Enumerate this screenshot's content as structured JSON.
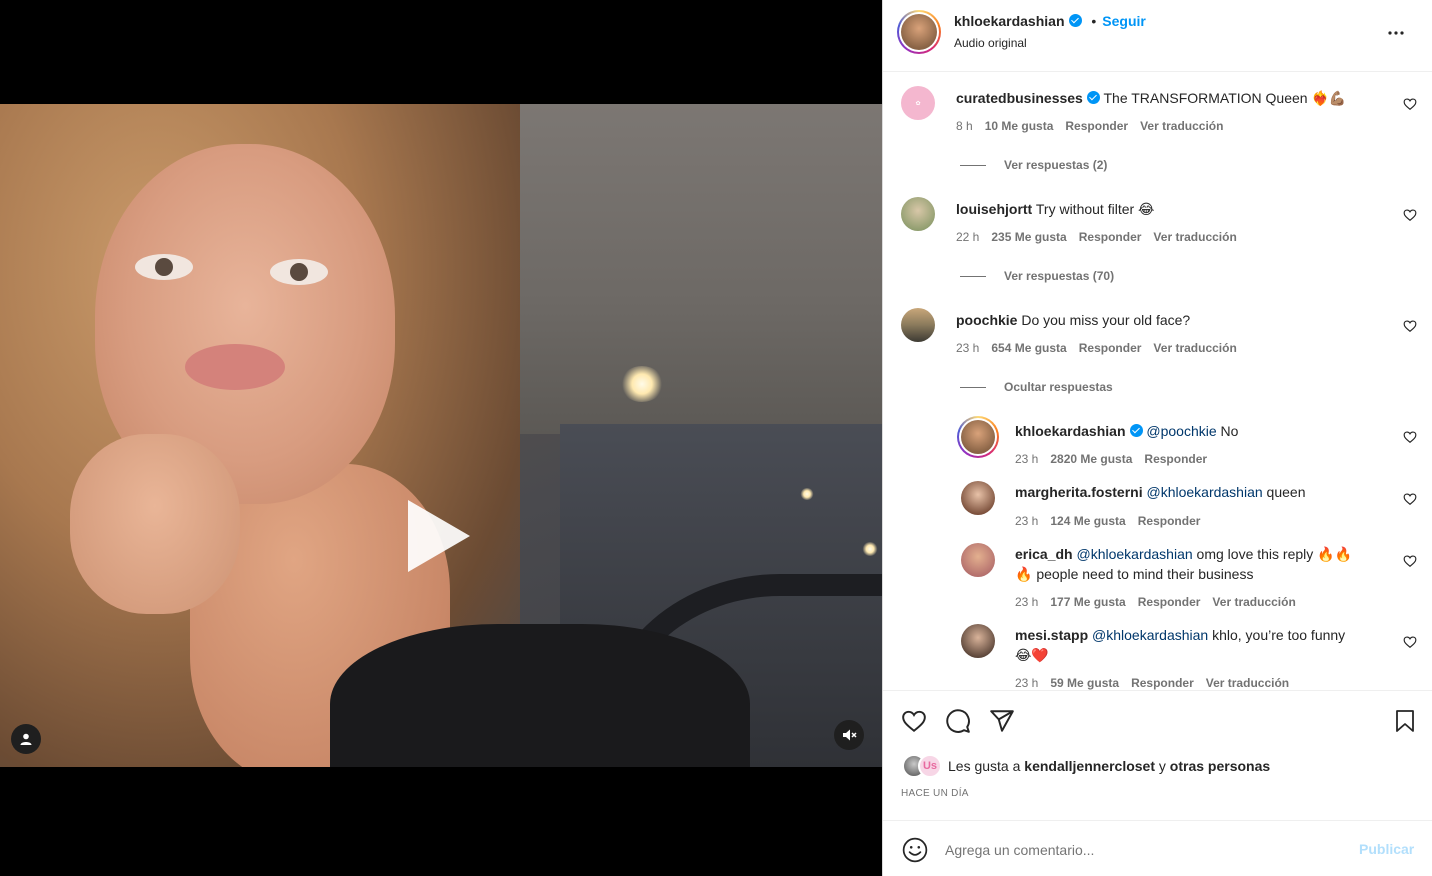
{
  "header": {
    "username": "khloekardashian",
    "dot": "•",
    "follow_label": "Seguir",
    "audio": "Audio original"
  },
  "comments": [
    {
      "user": "curatedbusinesses",
      "verified": true,
      "text": "The TRANSFORMATION Queen ❤️‍🔥💪🏽",
      "time": "8 h",
      "likes": "10 Me gusta",
      "reply": "Responder",
      "translate": "Ver traducción",
      "replies_toggle": "Ver respuestas (2)"
    },
    {
      "user": "louisehjortt",
      "verified": false,
      "text": "Try without filter 😂",
      "time": "22 h",
      "likes": "235 Me gusta",
      "reply": "Responder",
      "translate": "Ver traducción",
      "replies_toggle": "Ver respuestas (70)"
    },
    {
      "user": "poochkie",
      "verified": false,
      "text": "Do you miss your old face?",
      "time": "23 h",
      "likes": "654 Me gusta",
      "reply": "Responder",
      "translate": "Ver traducción",
      "replies_toggle": "Ocultar respuestas"
    }
  ],
  "replies": [
    {
      "user": "khloekardashian",
      "verified": true,
      "mention": "@poochkie",
      "text": " No",
      "time": "23 h",
      "likes": "2820 Me gusta",
      "reply": "Responder"
    },
    {
      "user": "margherita.fosterni",
      "verified": false,
      "mention": "@khloekardashian",
      "text": " queen",
      "time": "23 h",
      "likes": "124 Me gusta",
      "reply": "Responder"
    },
    {
      "user": "erica_dh",
      "verified": false,
      "mention": "@khloekardashian",
      "text": " omg love this reply 🔥🔥",
      "text2": "🔥 people need to mind their business",
      "time": "23 h",
      "likes": "177 Me gusta",
      "reply": "Responder",
      "translate": "Ver traducción"
    },
    {
      "user": "mesi.stapp",
      "verified": false,
      "mention": "@khloekardashian",
      "text": " khlo, you’re too funny",
      "text2": "😂❤️",
      "time": "23 h",
      "likes": "59 Me gusta",
      "reply": "Responder",
      "translate": "Ver traducción"
    }
  ],
  "likes": {
    "prefix": "Les gusta a ",
    "user": "kendalljennercloset",
    "middle": " y ",
    "others": "otras personas"
  },
  "timestamp": "HACE UN DÍA",
  "composer": {
    "placeholder": "Agrega un comentario...",
    "publish": "Publicar"
  },
  "colors": {
    "link": "#0095f6",
    "mention": "#00376b",
    "muted": "#737373",
    "publish_disabled": "#b2dffc"
  }
}
